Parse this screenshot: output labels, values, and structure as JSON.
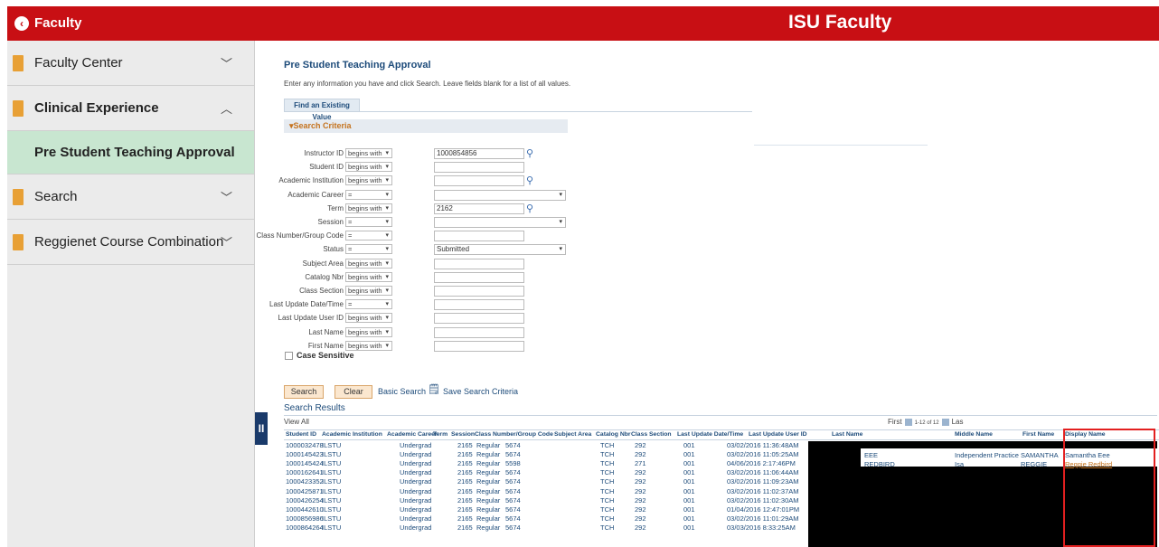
{
  "header": {
    "back_label": "Faculty",
    "title": "ISU Faculty"
  },
  "sidebar": {
    "items": [
      {
        "label": "Faculty Center",
        "chevron": "﹀"
      },
      {
        "label": "Clinical Experience",
        "chevron": "︿"
      },
      {
        "label": "Pre Student Teaching Approval"
      },
      {
        "label": "Search",
        "chevron": "﹀"
      },
      {
        "label": "Reggienet Course Combination",
        "chevron": "﹀"
      }
    ]
  },
  "page": {
    "title": "Pre Student Teaching Approval",
    "instructions": "Enter any information you have and click Search. Leave fields blank for a list of all values.",
    "tab_label": "Find an Existing Value",
    "criteria_label": "▾Search Criteria"
  },
  "criteria": [
    {
      "label": "Instructor ID",
      "op": "begins with",
      "value": "1000854856",
      "lookup": true
    },
    {
      "label": "Student ID",
      "op": "begins with",
      "value": ""
    },
    {
      "label": "Academic Institution",
      "op": "begins with",
      "value": "",
      "lookup": true
    },
    {
      "label": "Academic Career",
      "op": "=",
      "value": "",
      "select": true
    },
    {
      "label": "Term",
      "op": "begins with",
      "value": "2162",
      "lookup": true
    },
    {
      "label": "Session",
      "op": "=",
      "value": "",
      "select": true
    },
    {
      "label": "Class Number/Group Code",
      "op": "=",
      "value": ""
    },
    {
      "label": "Status",
      "op": "=",
      "value": "Submitted",
      "select": true
    },
    {
      "label": "Subject Area",
      "op": "begins with",
      "value": ""
    },
    {
      "label": "Catalog Nbr",
      "op": "begins with",
      "value": ""
    },
    {
      "label": "Class Section",
      "op": "begins with",
      "value": ""
    },
    {
      "label": "Last Update Date/Time",
      "op": "=",
      "value": ""
    },
    {
      "label": "Last Update User ID",
      "op": "begins with",
      "value": ""
    },
    {
      "label": "Last Name",
      "op": "begins with",
      "value": ""
    },
    {
      "label": "First Name",
      "op": "begins with",
      "value": ""
    }
  ],
  "case_sensitive_label": "Case Sensitive",
  "buttons": {
    "search": "Search",
    "clear": "Clear",
    "basic_search": "Basic Search",
    "save_criteria": "Save Search Criteria"
  },
  "results": {
    "title": "Search Results",
    "view_all": "View All",
    "nav_first": "First",
    "nav_range": "1-12 of 12",
    "nav_last": "Las",
    "columns": [
      "Student ID",
      "Academic Institution",
      "Academic Career",
      "Term",
      "Session",
      "Class Number/Group Code",
      "Subject Area",
      "Catalog Nbr",
      "Class Section",
      "Last Update Date/Time",
      "Last Update User ID",
      "Last Name",
      "Middle Name",
      "First Name",
      "Display Name"
    ],
    "rows": [
      [
        "1000032478",
        "ILSTU",
        "Undergrad",
        "2165",
        "Regular",
        "5674",
        "TCH",
        "292",
        "001",
        "03/02/2016 11:36:48AM"
      ],
      [
        "1000145423",
        "ILSTU",
        "Undergrad",
        "2165",
        "Regular",
        "5674",
        "TCH",
        "292",
        "001",
        "03/02/2016 11:05:25AM"
      ],
      [
        "1000145424",
        "ILSTU",
        "Undergrad",
        "2165",
        "Regular",
        "5598",
        "TCH",
        "271",
        "001",
        "04/06/2016 2:17:46PM"
      ],
      [
        "1000162641",
        "ILSTU",
        "Undergrad",
        "2165",
        "Regular",
        "5674",
        "TCH",
        "292",
        "001",
        "03/02/2016 11:06:44AM"
      ],
      [
        "1000423352",
        "ILSTU",
        "Undergrad",
        "2165",
        "Regular",
        "5674",
        "TCH",
        "292",
        "001",
        "03/02/2016 11:09:23AM"
      ],
      [
        "1000425871",
        "ILSTU",
        "Undergrad",
        "2165",
        "Regular",
        "5674",
        "TCH",
        "292",
        "001",
        "03/02/2016 11:02:37AM"
      ],
      [
        "1000426254",
        "ILSTU",
        "Undergrad",
        "2165",
        "Regular",
        "5674",
        "TCH",
        "292",
        "001",
        "03/02/2016 11:02:30AM"
      ],
      [
        "1000442610",
        "ILSTU",
        "Undergrad",
        "2165",
        "Regular",
        "5674",
        "TCH",
        "292",
        "001",
        "01/04/2016 12:47:01PM"
      ],
      [
        "1000856986",
        "ILSTU",
        "Undergrad",
        "2165",
        "Regular",
        "5674",
        "TCH",
        "292",
        "001",
        "03/02/2016 11:01:29AM"
      ],
      [
        "1000864264",
        "ILSTU",
        "Undergrad",
        "2165",
        "Regular",
        "5674",
        "TCH",
        "292",
        "001",
        "03/03/2016 8:33:25AM"
      ]
    ],
    "visible_names": [
      {
        "last": "EEE",
        "middle": "Independent Practice",
        "first": "SAMANTHA",
        "display": "Samantha Eee"
      },
      {
        "last": "REDBIRD",
        "middle": "Isa",
        "first": "REGGIE",
        "display": "Reggie Redbird"
      }
    ]
  }
}
